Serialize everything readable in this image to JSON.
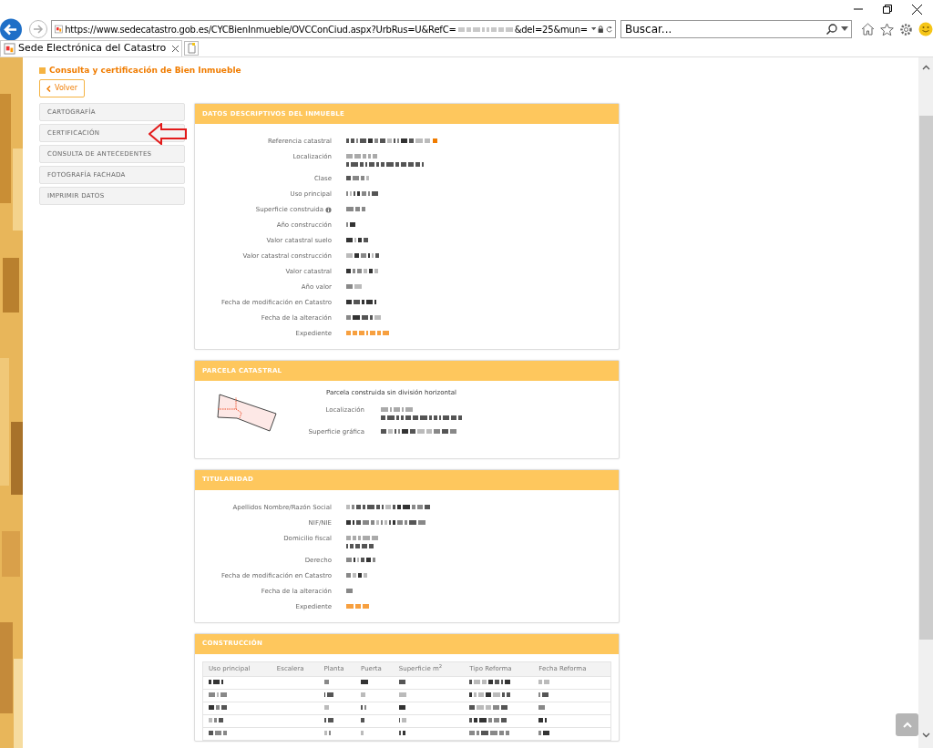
{
  "browser": {
    "url_start": "https://www.sedecatastro.gob.es/CYCBienInmueble/OVCConCiud.aspx?UrbRus=U&RefC=",
    "url_end": "&del=25&mun=",
    "search": {
      "placeholder": "Buscar..."
    },
    "tabs": [
      {
        "label": "Sede Electrónica del Catastro",
        "selected": true
      }
    ]
  },
  "page": {
    "title": "Consulta y certificación de Bien Inmueble",
    "back_button": "Volver",
    "menu": [
      {
        "label": "CARTOGRAFÍA"
      },
      {
        "label": "CERTIFICACIÓN"
      },
      {
        "label": "CONSULTA DE ANTECEDENTES"
      },
      {
        "label": "FOTOGRAFÍA FACHADA"
      },
      {
        "label": "IMPRIMIR DATOS"
      }
    ],
    "sections": [
      {
        "kind": "fields",
        "title": "DATOS DESCRIPTIVOS DEL INMUEBLE",
        "fields": [
          {
            "label": "Referencia catastral",
            "kind": "reference"
          },
          {
            "label": "Localización",
            "kind": "address"
          },
          {
            "label": "Clase",
            "kind": "text"
          },
          {
            "label": "Uso principal",
            "kind": "text"
          },
          {
            "label": "Superficie construida",
            "kind": "text",
            "info": true
          },
          {
            "label": "Año construcción",
            "kind": "text"
          },
          {
            "label": "Valor catastral suelo",
            "kind": "text"
          },
          {
            "label": "Valor catastral construcción",
            "kind": "text"
          },
          {
            "label": "Valor catastral",
            "kind": "text"
          },
          {
            "label": "Año valor",
            "kind": "text"
          },
          {
            "label": "Fecha de modificación en Catastro",
            "kind": "text"
          },
          {
            "label": "Fecha de la alteración",
            "kind": "text"
          },
          {
            "label": "Expediente",
            "kind": "link"
          }
        ]
      },
      {
        "kind": "parcel",
        "title": "PARCELA CATASTRAL",
        "caption": "Parcela construida sin división horizontal",
        "fields": [
          {
            "label": "Localización",
            "kind": "address"
          },
          {
            "label": "Superficie gráfica",
            "kind": "text"
          }
        ]
      },
      {
        "kind": "fields",
        "title": "TITULARIDAD",
        "fields": [
          {
            "label": "Apellidos Nombre/Razón Social",
            "kind": "text"
          },
          {
            "label": "NIF/NIE",
            "kind": "text"
          },
          {
            "label": "Domicilio fiscal",
            "kind": "address"
          },
          {
            "label": "Derecho",
            "kind": "text"
          },
          {
            "label": "Fecha de modificación en Catastro",
            "kind": "text"
          },
          {
            "label": "Fecha de la alteración",
            "kind": "text"
          },
          {
            "label": "Expediente",
            "kind": "link"
          }
        ]
      },
      {
        "kind": "table",
        "title": "CONSTRUCCIÓN",
        "columns": [
          "Uso principal",
          "Escalera",
          "Planta",
          "Puerta",
          "Superficie m$^{2}$",
          "Tipo Reforma",
          "Fecha Reforma"
        ],
        "rows": [
          {
            "redacted": true
          },
          {
            "redacted": true
          },
          {
            "redacted": true
          },
          {
            "redacted": true
          },
          {
            "redacted": true
          }
        ]
      }
    ]
  }
}
